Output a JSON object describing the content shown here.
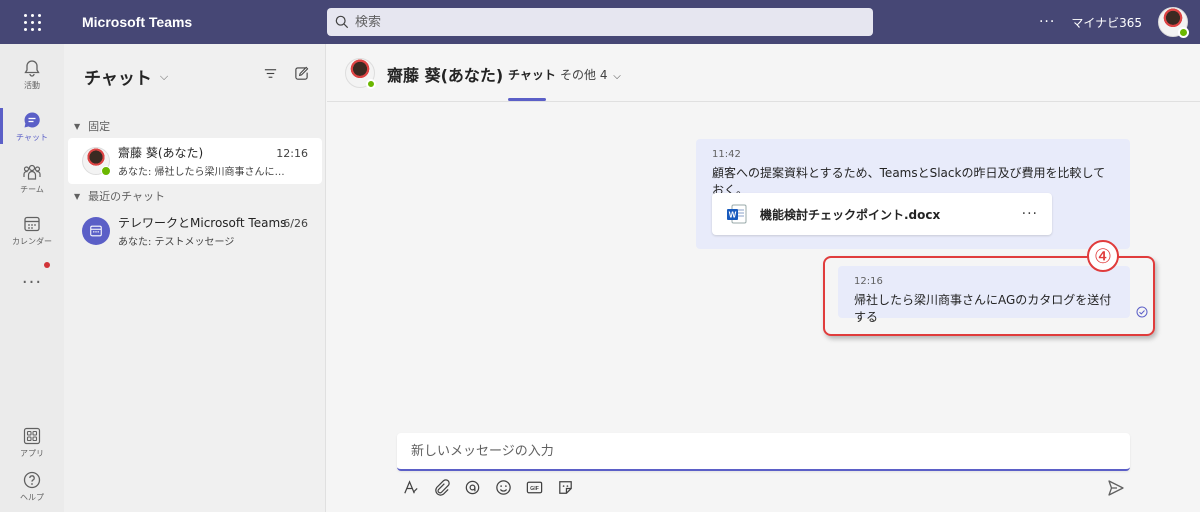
{
  "app": {
    "title": "Microsoft Teams"
  },
  "search": {
    "placeholder": "検索"
  },
  "topbar": {
    "more": "···",
    "org_name": "マイナビ365"
  },
  "rail": {
    "items": [
      {
        "label": "活動",
        "icon": "bell-icon"
      },
      {
        "label": "チャット",
        "icon": "chat-icon"
      },
      {
        "label": "チーム",
        "icon": "teams-icon"
      },
      {
        "label": "カレンダー",
        "icon": "calendar-icon"
      },
      {
        "label": "アプリ",
        "icon": "apps-icon"
      },
      {
        "label": "ヘルプ",
        "icon": "help-icon"
      }
    ],
    "more": "···"
  },
  "chatlist": {
    "title": "チャット",
    "sections": [
      {
        "label": "固定"
      },
      {
        "label": "最近のチャット"
      }
    ],
    "chats": [
      {
        "name": "齋藤 葵(あなた)",
        "preview": "あなた: 帰社したら梁川商事さんにA...",
        "time": "12:16"
      },
      {
        "name": "テレワークとMicrosoft Teams",
        "preview": "あなた: テストメッセージ",
        "time": "6/26"
      }
    ]
  },
  "conversation": {
    "name": "齋藤 葵(あなた)",
    "tabs": [
      {
        "label": "チャット"
      },
      {
        "label": "その他 4"
      }
    ],
    "messages": [
      {
        "time": "11:42",
        "text": "顧客への提案資料とするため、TeamsとSlackの昨日及び費用を比較しておく。",
        "attachment": {
          "name": "機能検討チェックポイント.docx",
          "more": "···"
        }
      },
      {
        "time": "12:16",
        "text": "帰社したら梁川商事さんにAGのカタログを送付する"
      }
    ],
    "annotation": "④"
  },
  "composer": {
    "placeholder": "新しいメッセージの入力"
  },
  "colors": {
    "brand": "#464775",
    "accent": "#5b5fc7",
    "highlight": "#e03c3c",
    "presence": "#6bb700"
  }
}
